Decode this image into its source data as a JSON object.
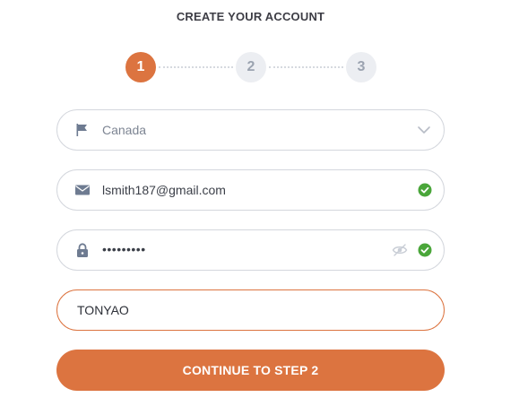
{
  "header": {
    "title": "CREATE YOUR ACCOUNT"
  },
  "stepper": {
    "current_step": 1,
    "steps": [
      {
        "label": "1",
        "state": "active"
      },
      {
        "label": "2",
        "state": "inactive"
      },
      {
        "label": "3",
        "state": "inactive"
      }
    ]
  },
  "form": {
    "country": {
      "value": "Canada",
      "icon": "flag-icon",
      "control": "chevron-down-icon"
    },
    "email": {
      "value": "lsmith187@gmail.com",
      "icon": "envelope-icon",
      "status": "valid"
    },
    "password": {
      "value": "•••••••••",
      "icon": "lock-icon",
      "toggle": "eye-slash-icon",
      "status": "valid"
    },
    "username": {
      "value": "TONYAO",
      "state": "focused"
    }
  },
  "actions": {
    "continue_label": "CONTINUE TO STEP 2"
  },
  "colors": {
    "accent": "#dc7440",
    "valid": "#4aa63a",
    "field_border": "#d4d7dd",
    "inactive_step": "#eceef2"
  }
}
